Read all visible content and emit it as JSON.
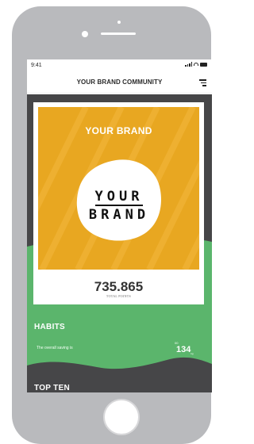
{
  "status_bar": {
    "time": "9:41"
  },
  "nav": {
    "title": "YOUR BRAND COMMUNITY"
  },
  "brand_card": {
    "title": "YOUR BRAND",
    "logo_line1": "YOUR",
    "logo_line2": "BRAND",
    "points_value": "735.865",
    "points_label": "TOTAL POINTS"
  },
  "habits": {
    "title": "HABITS",
    "description": "The overall saving is",
    "small_label": "00",
    "value": "134",
    "value_unit": "kg"
  },
  "top_ten": {
    "title": "TOP TEN"
  },
  "colors": {
    "brand_orange": "#e8a721",
    "green": "#5bb56c",
    "dark": "#464648",
    "phone_frame": "#b9babd"
  }
}
